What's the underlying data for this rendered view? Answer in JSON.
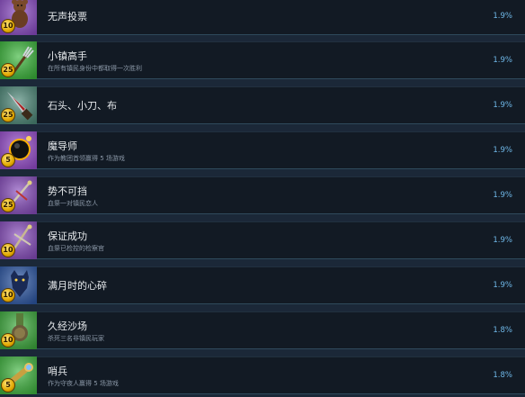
{
  "achievements": [
    {
      "title": "无声投票",
      "desc": "",
      "percent": "1.9%",
      "points": "10",
      "icon": "teddy-bear-icon",
      "bg": "#8f4fc9"
    },
    {
      "title": "小镇高手",
      "desc": "在所有镇民身份中都取得一次胜利",
      "percent": "1.9%",
      "points": "25",
      "icon": "pitchfork-icon",
      "bg": "#3cb83c"
    },
    {
      "title": "石头、小刀、布",
      "desc": "",
      "percent": "1.9%",
      "points": "25",
      "icon": "knife-icon",
      "bg": "#4f8a7a"
    },
    {
      "title": "魔导师",
      "desc": "作为教团首领赢得 5 场游戏",
      "percent": "1.9%",
      "points": "5",
      "icon": "dark-orb-icon",
      "bg": "#9a4fd0"
    },
    {
      "title": "势不可挡",
      "desc": "血祭一对镇民恋人",
      "percent": "1.9%",
      "points": "25",
      "icon": "ritual-dagger-icon",
      "bg": "#8a4fc0"
    },
    {
      "title": "保证成功",
      "desc": "血祭已检控的检察官",
      "percent": "1.9%",
      "points": "10",
      "icon": "ritual-staff-icon",
      "bg": "#8a4fc0"
    },
    {
      "title": "满月时的心碎",
      "desc": "",
      "percent": "1.9%",
      "points": "10",
      "icon": "werewolf-icon",
      "bg": "#2f5aa8"
    },
    {
      "title": "久经沙场",
      "desc": "杀死三名非镇民玩家",
      "percent": "1.8%",
      "points": "10",
      "icon": "medal-icon",
      "bg": "#3fae3f"
    },
    {
      "title": "哨兵",
      "desc": "作为守夜人赢得 5 场游戏",
      "percent": "1.8%",
      "points": "5",
      "icon": "spyglass-icon",
      "bg": "#42b842"
    }
  ]
}
